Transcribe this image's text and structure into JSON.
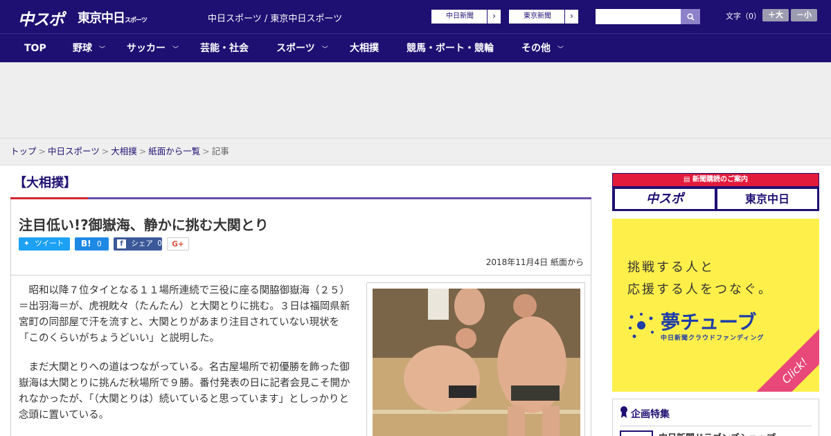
{
  "header": {
    "logo_main": "中スポ",
    "logo_tokyo": "東京中日",
    "logo_tokyo_small": "スポーツ",
    "site_title": "中日スポーツ / 東京中日スポーツ",
    "paper_links": [
      {
        "label": "中日新聞"
      },
      {
        "label": "東京新聞"
      }
    ],
    "search": {
      "placeholder": "",
      "value": ""
    },
    "font_size": {
      "label": "文字（0）",
      "larger": "＋大",
      "smaller": "－小"
    }
  },
  "nav": {
    "items": [
      {
        "label": "TOP",
        "has_menu": false
      },
      {
        "label": "野球",
        "has_menu": true
      },
      {
        "label": "サッカー",
        "has_menu": true
      },
      {
        "label": "芸能・社会",
        "has_menu": false
      },
      {
        "label": "スポーツ",
        "has_menu": true
      },
      {
        "label": "大相撲",
        "has_menu": false
      },
      {
        "label": "競馬・ボート・競輪",
        "has_menu": false
      },
      {
        "label": "その他",
        "has_menu": true
      }
    ]
  },
  "breadcrumb": {
    "items": [
      "トップ",
      "中日スポーツ",
      "大相撲",
      "紙面から一覧"
    ],
    "current": "記事"
  },
  "article": {
    "category": "【大相撲】",
    "headline": "注目低い!?御嶽海、静かに挑む大関とり",
    "share": {
      "tweet": "ツイート",
      "hatena_count": "0",
      "facebook": "シェア",
      "facebook_count": "0",
      "gplus": "G+"
    },
    "date": "2018年11月4日 紙面から",
    "paragraphs": [
      "　昭和以降７位タイとなる１１場所連続で三役に座る関脇御嶽海（２５）＝出羽海＝が、虎視眈々（たんたん）と大関とりに挑む。３日は福岡県新宮町の同部屋で汗を流すと、大関とりがあまり注目されていない現状を「このくらいがちょうどいい」と説明した。",
      "　まだ大関とりへの道はつながっている。名古屋場所で初優勝を飾った御嶽海は大関とりに挑んだ秋場所で９勝。番付発表の日に記者会見こそ開かれなかったが、「（大関とりは）続いていると思っています」としっかりと念頭に置いている。"
    ]
  },
  "sidebar": {
    "subscription": {
      "title": "新聞購読のご案内",
      "logos": [
        "中スポ",
        "東京中日"
      ]
    },
    "ad": {
      "line1": "挑戦する人と",
      "line2": "応援する人をつなぐ。",
      "logo": "夢チューブ",
      "sub": "中日新聞クラウドファンディング",
      "click": "Click!"
    },
    "special": {
      "title": "企画特集",
      "item": "中日新聞ドラゴンズショップ"
    }
  },
  "colors": {
    "brand": "#1e0f72",
    "accent_red": "#e21b3c",
    "ad_yellow": "#ffef4a"
  }
}
